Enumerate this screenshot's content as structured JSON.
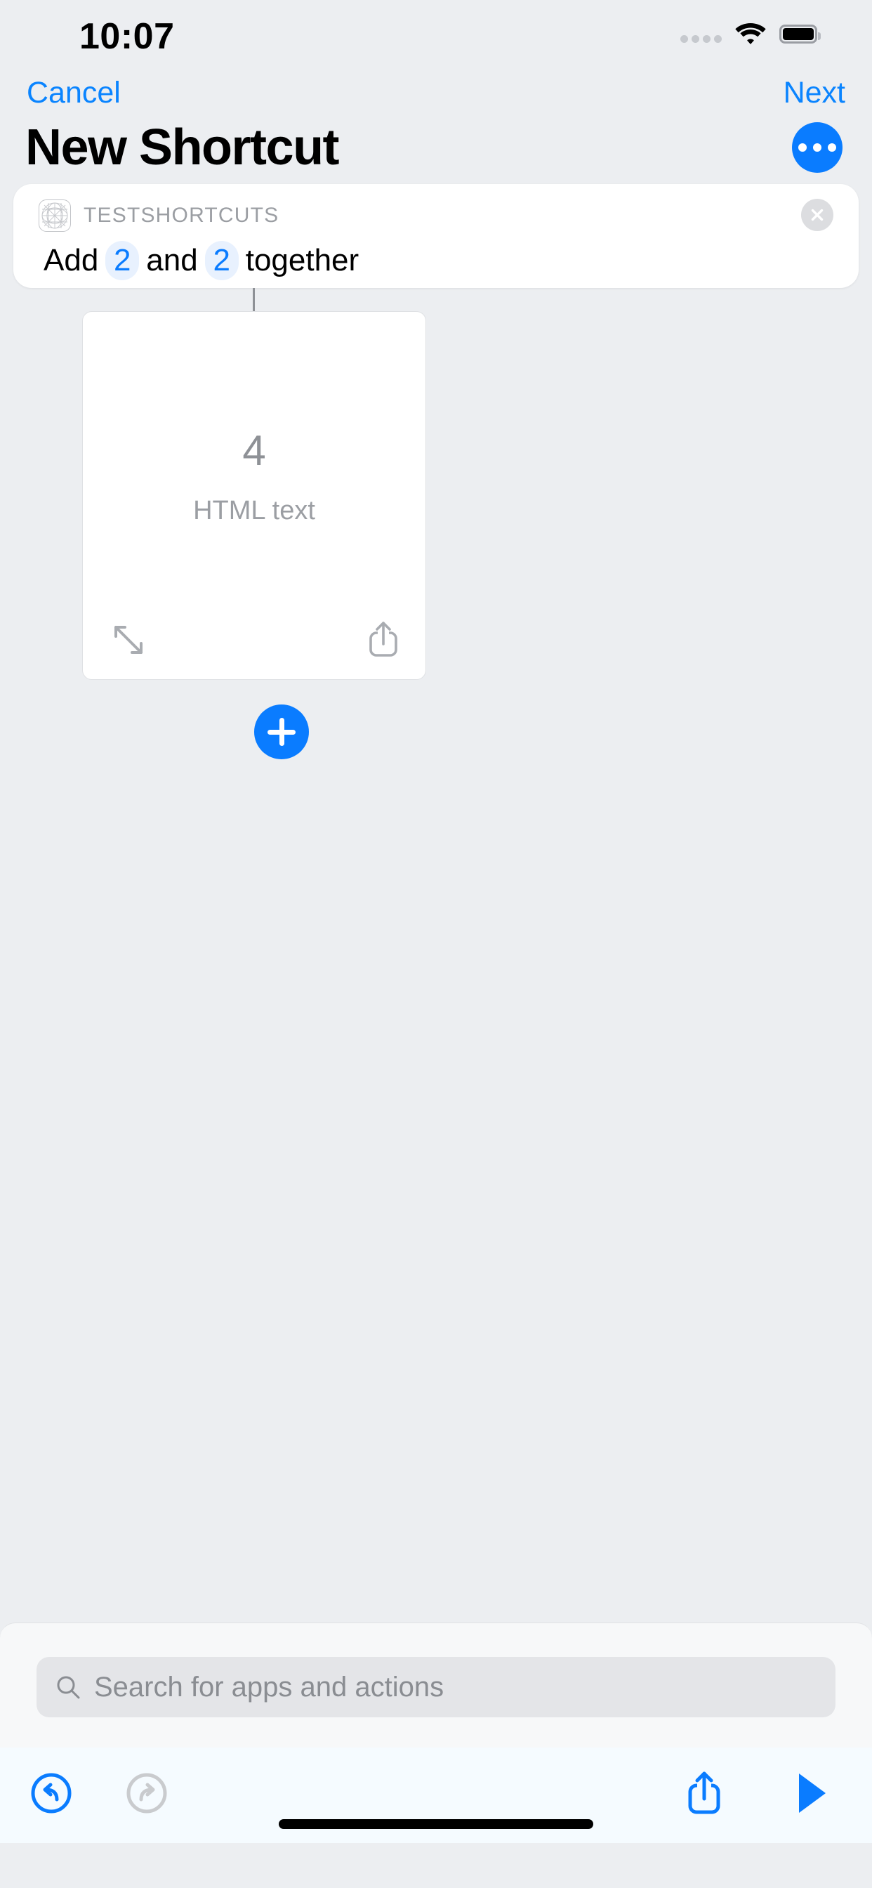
{
  "status_bar": {
    "time": "10:07",
    "cellular_icon": "cellular-dots-icon",
    "wifi_icon": "wifi-icon",
    "battery_icon": "battery-full-icon"
  },
  "nav": {
    "cancel_label": "Cancel",
    "next_label": "Next",
    "title": "New Shortcut",
    "more_icon": "ellipsis-icon"
  },
  "action_card": {
    "app_name": "TESTSHORTCUTS",
    "app_icon": "app-placeholder-icon",
    "close_icon": "close-circle-icon",
    "text_part_1": "Add",
    "token_1": "2",
    "text_part_2": "and",
    "token_2": "2",
    "text_part_3": "together"
  },
  "result_card": {
    "value": "4",
    "label": "HTML text",
    "expand_icon": "expand-arrows-icon",
    "share_icon": "share-icon"
  },
  "add_button": {
    "icon": "plus-icon"
  },
  "search": {
    "placeholder": "Search for apps and actions",
    "value": "",
    "icon": "search-icon"
  },
  "toolbar": {
    "undo_icon": "undo-icon",
    "redo_icon": "redo-icon",
    "share_icon": "share-icon",
    "play_icon": "play-icon"
  },
  "colors": {
    "accent": "#0a7cff",
    "link": "#0a84ff",
    "background": "#eceef1",
    "card": "#ffffff",
    "token_bg": "#e8f1fe",
    "muted_text": "#8e9196"
  }
}
